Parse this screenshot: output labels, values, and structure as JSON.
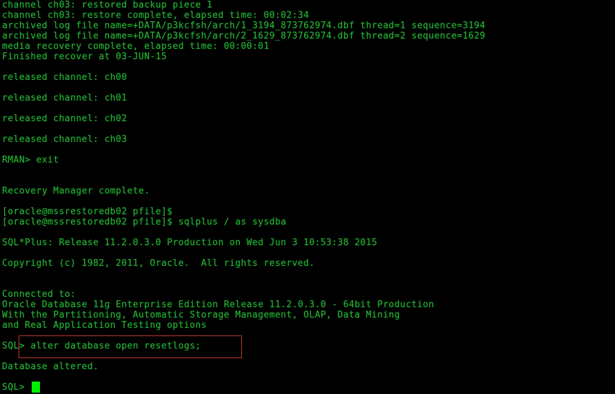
{
  "terminal": {
    "title": "oracle@mssrestoredb02 terminal",
    "background_color": "#000000",
    "text_color": "#23b233",
    "cursor_color": "#00ee00",
    "highlight_box_color": "#c0392b",
    "columns": 98,
    "rows": 38,
    "lines": [
      "channel ch03: restored backup piece 1",
      "channel ch03: restore complete, elapsed time: 00:02:34",
      "archived log file name=+DATA/p3kcfsh/arch/1_3194_873762974.dbf thread=1 sequence=3194",
      "archived log file name=+DATA/p3kcfsh/arch/2_1629_873762974.dbf thread=2 sequence=1629",
      "media recovery complete, elapsed time: 00:00:01",
      "Finished recover at 03-JUN-15",
      "",
      "released channel: ch00",
      "",
      "released channel: ch01",
      "",
      "released channel: ch02",
      "",
      "released channel: ch03",
      "",
      "RMAN> exit",
      "",
      "",
      "Recovery Manager complete.",
      "",
      "[oracle@mssrestoredb02 pfile]$",
      "[oracle@mssrestoredb02 pfile]$ sqlplus / as sysdba",
      "",
      "SQL*Plus: Release 11.2.0.3.0 Production on Wed Jun 3 10:53:38 2015",
      "",
      "Copyright (c) 1982, 2011, Oracle.  All rights reserved.",
      "",
      "",
      "Connected to:",
      "Oracle Database 11g Enterprise Edition Release 11.2.0.3.0 - 64bit Production",
      "With the Partitioning, Automatic Storage Management, OLAP, Data Mining",
      "and Real Application Testing options",
      "",
      "SQL> alter database open resetlogs;",
      "",
      "Database altered.",
      "",
      "SQL> "
    ],
    "highlighted_command": "alter database open resetlogs;",
    "prompt": "SQL> ",
    "cursor": "block-cursor"
  }
}
